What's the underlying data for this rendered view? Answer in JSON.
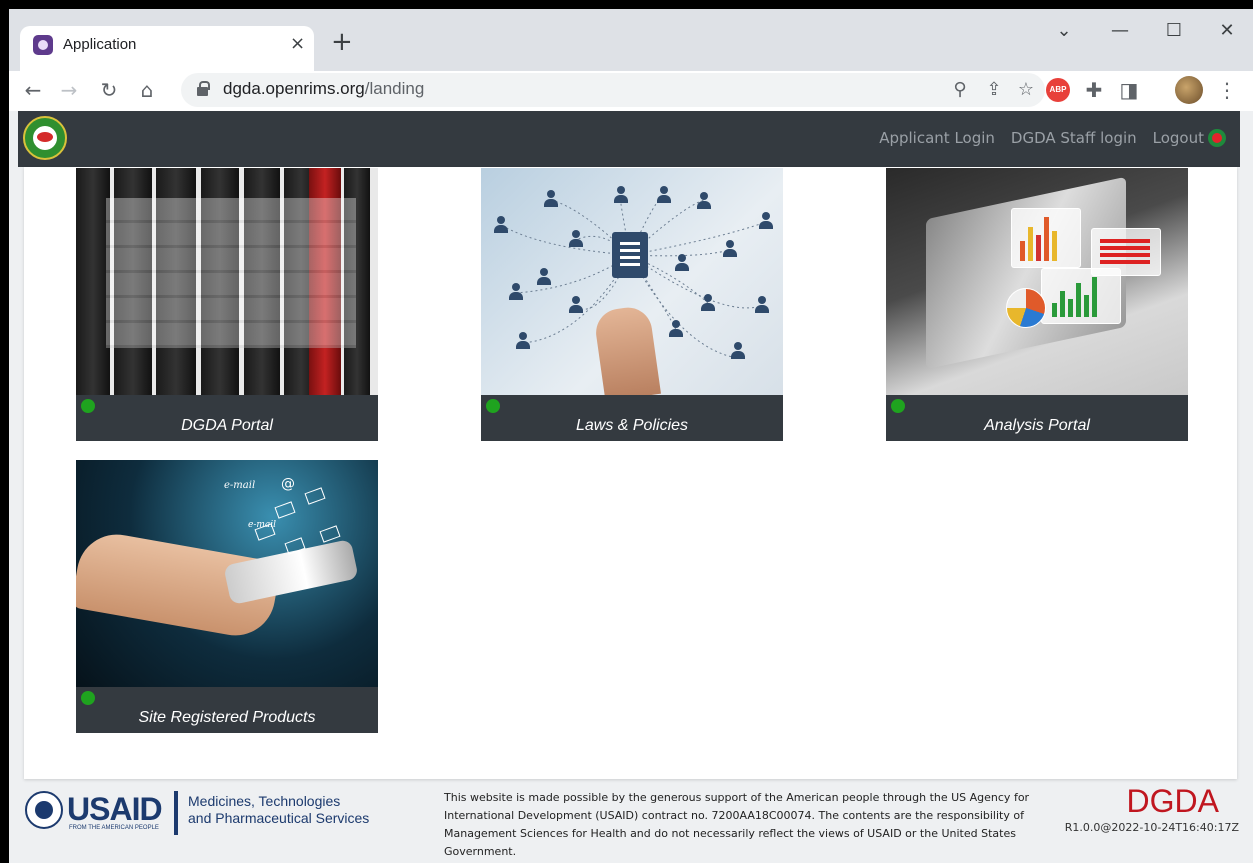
{
  "browser": {
    "tab_title": "Application",
    "tab_close": "×",
    "new_tab": "+",
    "url_host": "dgda.openrims.org",
    "url_path": "/landing",
    "tab_search": "⌄",
    "minimize": "—",
    "maximize": "☐",
    "close": "✕",
    "back": "←",
    "forward": "→",
    "reload": "↻",
    "home": "⌂",
    "zoom": "⚲",
    "share": "⇪",
    "bookmark": "☆",
    "adblock": "ABP",
    "extensions": "✚",
    "sidepanel": "◨",
    "menu": "⋮"
  },
  "navbar": {
    "links": [
      "Applicant Login",
      "DGDA Staff login",
      "Logout"
    ]
  },
  "cards": [
    {
      "title": "DGDA Portal"
    },
    {
      "title": "Laws & Policies"
    },
    {
      "title": "Analysis Portal"
    },
    {
      "title": "Site Registered Products"
    }
  ],
  "email_art": {
    "label1": "e-mail",
    "label2": "e-mail",
    "at": "@"
  },
  "footer": {
    "usaid": "USAID",
    "usaid_tagline": "FROM THE AMERICAN PEOPLE",
    "mtaps_line1": "Medicines, Technologies",
    "mtaps_line2": "and Pharmaceutical Services",
    "disclaimer": "This website is made possible by the generous support of the American people through the US Agency for International Development (USAID) contract no. 7200AA18C00074. The contents are the responsibility of Management Sciences for Health and do not necessarily reflect the views of USAID or the United States Government.",
    "brand": "DGDA",
    "version": "R1.0.0@2022-10-24T16:40:17Z"
  },
  "colors": {
    "navbar": "#343a40",
    "status_dot": "#1fa31f",
    "brand_red": "#c0161f",
    "usaid_blue": "#1c3a6e"
  }
}
